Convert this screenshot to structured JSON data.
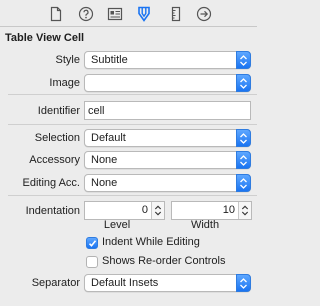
{
  "tabs": [
    {
      "icon": "file-icon",
      "active": false
    },
    {
      "icon": "help-icon",
      "active": false
    },
    {
      "icon": "identity-icon",
      "active": false
    },
    {
      "icon": "attributes-icon",
      "active": true
    },
    {
      "icon": "size-ruler-icon",
      "active": false
    },
    {
      "icon": "connections-arrow-icon",
      "active": false
    }
  ],
  "accent_color": "#1a74f2",
  "section_title": "Table View Cell",
  "style": {
    "label": "Style",
    "value": "Subtitle"
  },
  "image": {
    "label": "Image",
    "value": ""
  },
  "identifier": {
    "label": "Identifier",
    "value": "cell"
  },
  "selection": {
    "label": "Selection",
    "value": "Default"
  },
  "accessory": {
    "label": "Accessory",
    "value": "None"
  },
  "editing_accessory": {
    "label": "Editing Acc.",
    "value": "None"
  },
  "indentation": {
    "label": "Indentation",
    "level": {
      "value": "0",
      "caption": "Level"
    },
    "width": {
      "value": "10",
      "caption": "Width"
    }
  },
  "indent_while_editing": {
    "label": "Indent While Editing",
    "checked": true
  },
  "shows_reorder_controls": {
    "label": "Shows Re-order Controls",
    "checked": false
  },
  "separator": {
    "label": "Separator",
    "value": "Default Insets"
  }
}
